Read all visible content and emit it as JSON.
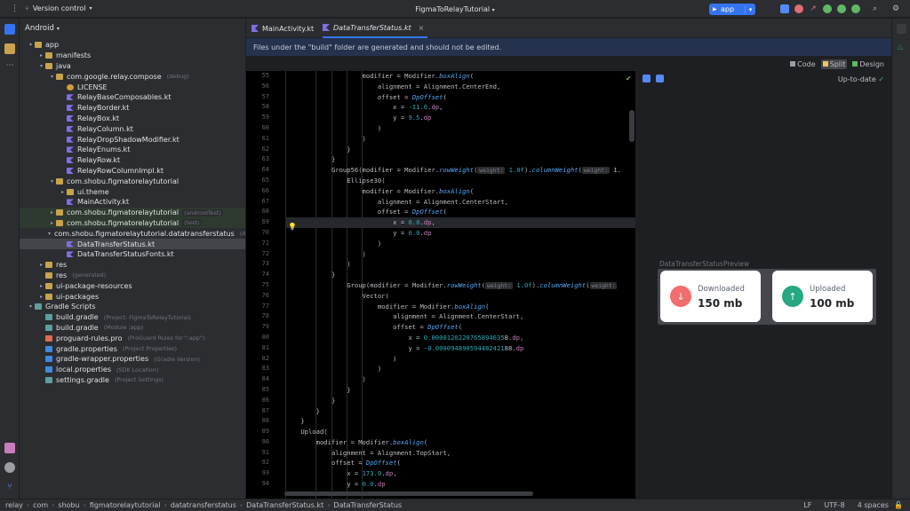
{
  "titlebar": {
    "vcs_label": "Version control",
    "project_title": "FigmaToRelayTutorial",
    "run_config": "app"
  },
  "project_panel": {
    "view_mode": "Android",
    "tree": [
      {
        "label": "app",
        "hint": "",
        "depth": 0,
        "arrow": "▾",
        "icon": "folder"
      },
      {
        "label": "manifests",
        "hint": "",
        "depth": 1,
        "arrow": "▸",
        "icon": "folder"
      },
      {
        "label": "java",
        "hint": "",
        "depth": 1,
        "arrow": "▾",
        "icon": "folder"
      },
      {
        "label": "com.google.relay.compose",
        "hint": "(debug)",
        "depth": 2,
        "arrow": "▾",
        "icon": "folder"
      },
      {
        "label": "LICENSE",
        "hint": "",
        "depth": 3,
        "arrow": "",
        "icon": "lic"
      },
      {
        "label": "RelayBaseComposables.kt",
        "hint": "",
        "depth": 3,
        "arrow": "",
        "icon": "kt"
      },
      {
        "label": "RelayBorder.kt",
        "hint": "",
        "depth": 3,
        "arrow": "",
        "icon": "kt"
      },
      {
        "label": "RelayBox.kt",
        "hint": "",
        "depth": 3,
        "arrow": "",
        "icon": "kt"
      },
      {
        "label": "RelayColumn.kt",
        "hint": "",
        "depth": 3,
        "arrow": "",
        "icon": "kt"
      },
      {
        "label": "RelayDropShadowModifier.kt",
        "hint": "",
        "depth": 3,
        "arrow": "",
        "icon": "kt"
      },
      {
        "label": "RelayEnums.kt",
        "hint": "",
        "depth": 3,
        "arrow": "",
        "icon": "kt"
      },
      {
        "label": "RelayRow.kt",
        "hint": "",
        "depth": 3,
        "arrow": "",
        "icon": "kt"
      },
      {
        "label": "RelayRowColumnImpl.kt",
        "hint": "",
        "depth": 3,
        "arrow": "",
        "icon": "kt"
      },
      {
        "label": "com.shobu.figmatorelaytutorial",
        "hint": "",
        "depth": 2,
        "arrow": "▾",
        "icon": "folder"
      },
      {
        "label": "ui.theme",
        "hint": "",
        "depth": 3,
        "arrow": "▸",
        "icon": "folder"
      },
      {
        "label": "MainActivity.kt",
        "hint": "",
        "depth": 3,
        "arrow": "",
        "icon": "kt"
      },
      {
        "label": "com.shobu.figmatorelaytutorial",
        "hint": "(androidTest)",
        "depth": 2,
        "arrow": "▸",
        "icon": "folder",
        "green": true
      },
      {
        "label": "com.shobu.figmatorelaytutorial",
        "hint": "(test)",
        "depth": 2,
        "arrow": "▸",
        "icon": "folder",
        "green": true
      },
      {
        "label": "com.shobu.figmatorelaytutorial.datatransferstatus",
        "hint": "(debug)",
        "depth": 2,
        "arrow": "▾",
        "icon": "folder"
      },
      {
        "label": "DataTransferStatus.kt",
        "hint": "",
        "depth": 3,
        "arrow": "",
        "icon": "kt",
        "selected": true
      },
      {
        "label": "DataTransferStatusFonts.kt",
        "hint": "",
        "depth": 3,
        "arrow": "",
        "icon": "kt"
      },
      {
        "label": "res",
        "hint": "",
        "depth": 1,
        "arrow": "▸",
        "icon": "folder"
      },
      {
        "label": "res",
        "hint": "(generated)",
        "depth": 1,
        "arrow": "",
        "icon": "folder"
      },
      {
        "label": "ui-package-resources",
        "hint": "",
        "depth": 1,
        "arrow": "▸",
        "icon": "folder"
      },
      {
        "label": "ui-packages",
        "hint": "",
        "depth": 1,
        "arrow": "▸",
        "icon": "folder"
      },
      {
        "label": "Gradle Scripts",
        "hint": "",
        "depth": 0,
        "arrow": "▾",
        "icon": "gradle"
      },
      {
        "label": "build.gradle",
        "hint": "(Project: FigmaToRelayTutorial)",
        "depth": 1,
        "arrow": "",
        "icon": "gradle"
      },
      {
        "label": "build.gradle",
        "hint": "(Module :app)",
        "depth": 1,
        "arrow": "",
        "icon": "gradle"
      },
      {
        "label": "proguard-rules.pro",
        "hint": "(ProGuard Rules for \":app\")",
        "depth": 1,
        "arrow": "",
        "icon": "pro"
      },
      {
        "label": "gradle.properties",
        "hint": "(Project Properties)",
        "depth": 1,
        "arrow": "",
        "icon": "xml"
      },
      {
        "label": "gradle-wrapper.properties",
        "hint": "(Gradle Version)",
        "depth": 1,
        "arrow": "",
        "icon": "xml"
      },
      {
        "label": "local.properties",
        "hint": "(SDK Location)",
        "depth": 1,
        "arrow": "",
        "icon": "xml"
      },
      {
        "label": "settings.gradle",
        "hint": "(Project Settings)",
        "depth": 1,
        "arrow": "",
        "icon": "gradle"
      }
    ]
  },
  "editor": {
    "tabs": [
      "MainActivity.kt",
      "DataTransferStatus.kt"
    ],
    "active_tab": 1,
    "banner": "Files under the \"build\" folder are generated and should not be edited.",
    "modes": [
      "Code",
      "Split",
      "Design"
    ],
    "active_mode": "Split",
    "current_line": 69,
    "code": [
      {
        "n": 55,
        "i": 10,
        "t": [
          [
            "modifier = Modifier.",
            ""
          ],
          [
            "boxAlign",
            "fn"
          ],
          [
            "(",
            ""
          ]
        ]
      },
      {
        "n": 56,
        "i": 11,
        "t": [
          [
            "alignment = Alignment.CenterEnd,",
            ""
          ]
        ]
      },
      {
        "n": 57,
        "i": 11,
        "t": [
          [
            "offset = ",
            ""
          ],
          [
            "DpOffset",
            "fn"
          ],
          [
            "(",
            ""
          ]
        ]
      },
      {
        "n": 58,
        "i": 12,
        "t": [
          [
            "x = ",
            ""
          ],
          [
            "-11.0",
            "num"
          ],
          [
            ".",
            ""
          ],
          [
            "dp",
            "prop"
          ],
          [
            ",",
            ""
          ]
        ]
      },
      {
        "n": 59,
        "i": 12,
        "t": [
          [
            "y = ",
            ""
          ],
          [
            "9.5",
            "num"
          ],
          [
            ".",
            ""
          ],
          [
            "dp",
            "prop"
          ]
        ]
      },
      {
        "n": 60,
        "i": 11,
        "t": [
          [
            ")",
            ""
          ]
        ]
      },
      {
        "n": 61,
        "i": 10,
        "t": [
          [
            ")",
            ""
          ]
        ]
      },
      {
        "n": 62,
        "i": 9,
        "t": [
          [
            "}",
            ""
          ]
        ]
      },
      {
        "n": 63,
        "i": 8,
        "t": [
          [
            "}",
            ""
          ]
        ]
      },
      {
        "n": 64,
        "i": 8,
        "t": [
          [
            "Group56(modifier = Modifier.",
            ""
          ],
          [
            "rowWeight",
            "fn"
          ],
          [
            "(",
            ""
          ],
          [
            "weight:",
            "hint"
          ],
          [
            " ",
            ""
          ],
          [
            "1.0f",
            "num"
          ],
          [
            ").",
            ""
          ],
          [
            "columnWeight",
            "fn"
          ],
          [
            "(",
            ""
          ],
          [
            "weight:",
            "hint"
          ],
          [
            " 1.",
            ""
          ]
        ]
      },
      {
        "n": 65,
        "i": 9,
        "t": [
          [
            "Ellipse30(",
            ""
          ]
        ]
      },
      {
        "n": 66,
        "i": 10,
        "t": [
          [
            "modifier = Modifier.",
            ""
          ],
          [
            "boxAlign",
            "fn"
          ],
          [
            "(",
            ""
          ]
        ]
      },
      {
        "n": 67,
        "i": 11,
        "t": [
          [
            "alignment = Alignment.CenterStart,",
            ""
          ]
        ]
      },
      {
        "n": 68,
        "i": 11,
        "t": [
          [
            "offset = ",
            ""
          ],
          [
            "DpOffset",
            "fn"
          ],
          [
            "(",
            ""
          ]
        ]
      },
      {
        "n": 69,
        "i": 12,
        "t": [
          [
            "x = ",
            ""
          ],
          [
            "0.0",
            "num"
          ],
          [
            ".",
            ""
          ],
          [
            "dp",
            "prop"
          ],
          [
            ",",
            ""
          ]
        ]
      },
      {
        "n": 70,
        "i": 12,
        "t": [
          [
            "y = ",
            ""
          ],
          [
            "0.0",
            "num"
          ],
          [
            ".",
            ""
          ],
          [
            "dp",
            "prop"
          ]
        ]
      },
      {
        "n": 71,
        "i": 11,
        "t": [
          [
            ")",
            ""
          ]
        ]
      },
      {
        "n": 72,
        "i": 10,
        "t": [
          [
            ")",
            ""
          ]
        ]
      },
      {
        "n": 73,
        "i": 9,
        "t": [
          [
            ")",
            ""
          ]
        ]
      },
      {
        "n": 74,
        "i": 8,
        "t": [
          [
            "}",
            ""
          ]
        ]
      },
      {
        "n": 75,
        "i": 9,
        "t": [
          [
            "Group(modifier = Modifier.",
            ""
          ],
          [
            "rowWeight",
            "fn"
          ],
          [
            "(",
            ""
          ],
          [
            "weight:",
            "hint"
          ],
          [
            " ",
            ""
          ],
          [
            "1.0f",
            "num"
          ],
          [
            ").",
            ""
          ],
          [
            "columnWeight",
            "fn"
          ],
          [
            "(",
            ""
          ],
          [
            "weight:",
            "hint"
          ]
        ]
      },
      {
        "n": 76,
        "i": 10,
        "t": [
          [
            "Vector(",
            ""
          ]
        ]
      },
      {
        "n": 77,
        "i": 11,
        "t": [
          [
            "modifier = Modifier.",
            ""
          ],
          [
            "boxAlign",
            "fn"
          ],
          [
            "(",
            ""
          ]
        ]
      },
      {
        "n": 78,
        "i": 12,
        "t": [
          [
            "alignment = Alignment.CenterStart,",
            ""
          ]
        ]
      },
      {
        "n": 79,
        "i": 12,
        "t": [
          [
            "offset = ",
            ""
          ],
          [
            "DpOffset",
            "fn"
          ],
          [
            "(",
            ""
          ]
        ]
      },
      {
        "n": 80,
        "i": 13,
        "t": [
          [
            "x = ",
            ""
          ],
          [
            "0.0000120220765894635",
            "num"
          ],
          [
            "8",
            ""
          ],
          [
            ".",
            ""
          ],
          [
            "dp",
            "prop"
          ],
          [
            ",",
            ""
          ]
        ]
      },
      {
        "n": 81,
        "i": 13,
        "t": [
          [
            "y = ",
            ""
          ],
          [
            "-0.000094890594482421",
            "num"
          ],
          [
            "88",
            ""
          ],
          [
            ".",
            ""
          ],
          [
            "dp",
            "prop"
          ]
        ]
      },
      {
        "n": 82,
        "i": 12,
        "t": [
          [
            ")",
            ""
          ]
        ]
      },
      {
        "n": 83,
        "i": 11,
        "t": [
          [
            ")",
            ""
          ]
        ]
      },
      {
        "n": 84,
        "i": 10,
        "t": [
          [
            ")",
            ""
          ]
        ]
      },
      {
        "n": 85,
        "i": 9,
        "t": [
          [
            "}",
            ""
          ]
        ]
      },
      {
        "n": 86,
        "i": 8,
        "t": [
          [
            "}",
            ""
          ]
        ]
      },
      {
        "n": 87,
        "i": 7,
        "t": [
          [
            "}",
            ""
          ]
        ]
      },
      {
        "n": 88,
        "i": 6,
        "t": [
          [
            "}",
            ""
          ]
        ]
      },
      {
        "n": 89,
        "i": 6,
        "t": [
          [
            "Upload(",
            ""
          ]
        ]
      },
      {
        "n": 90,
        "i": 7,
        "t": [
          [
            "modifier = Modifier.",
            ""
          ],
          [
            "boxAlign",
            "fn"
          ],
          [
            "(",
            ""
          ]
        ]
      },
      {
        "n": 91,
        "i": 8,
        "t": [
          [
            "alignment = Alignment.TopStart,",
            ""
          ]
        ]
      },
      {
        "n": 92,
        "i": 8,
        "t": [
          [
            "offset = ",
            ""
          ],
          [
            "DpOffset",
            "fn"
          ],
          [
            "(",
            ""
          ]
        ]
      },
      {
        "n": 93,
        "i": 9,
        "t": [
          [
            "x = ",
            ""
          ],
          [
            "173.0",
            "num"
          ],
          [
            ".",
            ""
          ],
          [
            "dp",
            "prop"
          ],
          [
            ",",
            ""
          ]
        ]
      },
      {
        "n": 94,
        "i": 9,
        "t": [
          [
            "y = ",
            ""
          ],
          [
            "0.0",
            "num"
          ],
          [
            ".",
            ""
          ],
          [
            "dp",
            "prop"
          ]
        ]
      }
    ]
  },
  "preview": {
    "status": "Up-to-date",
    "label": "DataTransferStatusPreview",
    "cards": [
      {
        "title": "Downloaded",
        "value": "150 mb",
        "icon": "arrow-down-icon",
        "glyph": "↓",
        "color": "#f26d6d"
      },
      {
        "title": "Uploaded",
        "value": "100 mb",
        "icon": "arrow-up-icon",
        "glyph": "↑",
        "color": "#26a882"
      }
    ]
  },
  "statusbar": {
    "breadcrumbs": [
      "relay",
      "com",
      "shobu",
      "figmatorelaytutorial",
      "datatransferstatus",
      "DataTransferStatus.kt",
      "DataTransferStatus"
    ],
    "line_sep": "LF",
    "encoding": "UTF-8",
    "indent": "4 spaces"
  },
  "colors": {
    "accent": "#3574f0",
    "download": "#f26d6d",
    "upload": "#26a882"
  }
}
